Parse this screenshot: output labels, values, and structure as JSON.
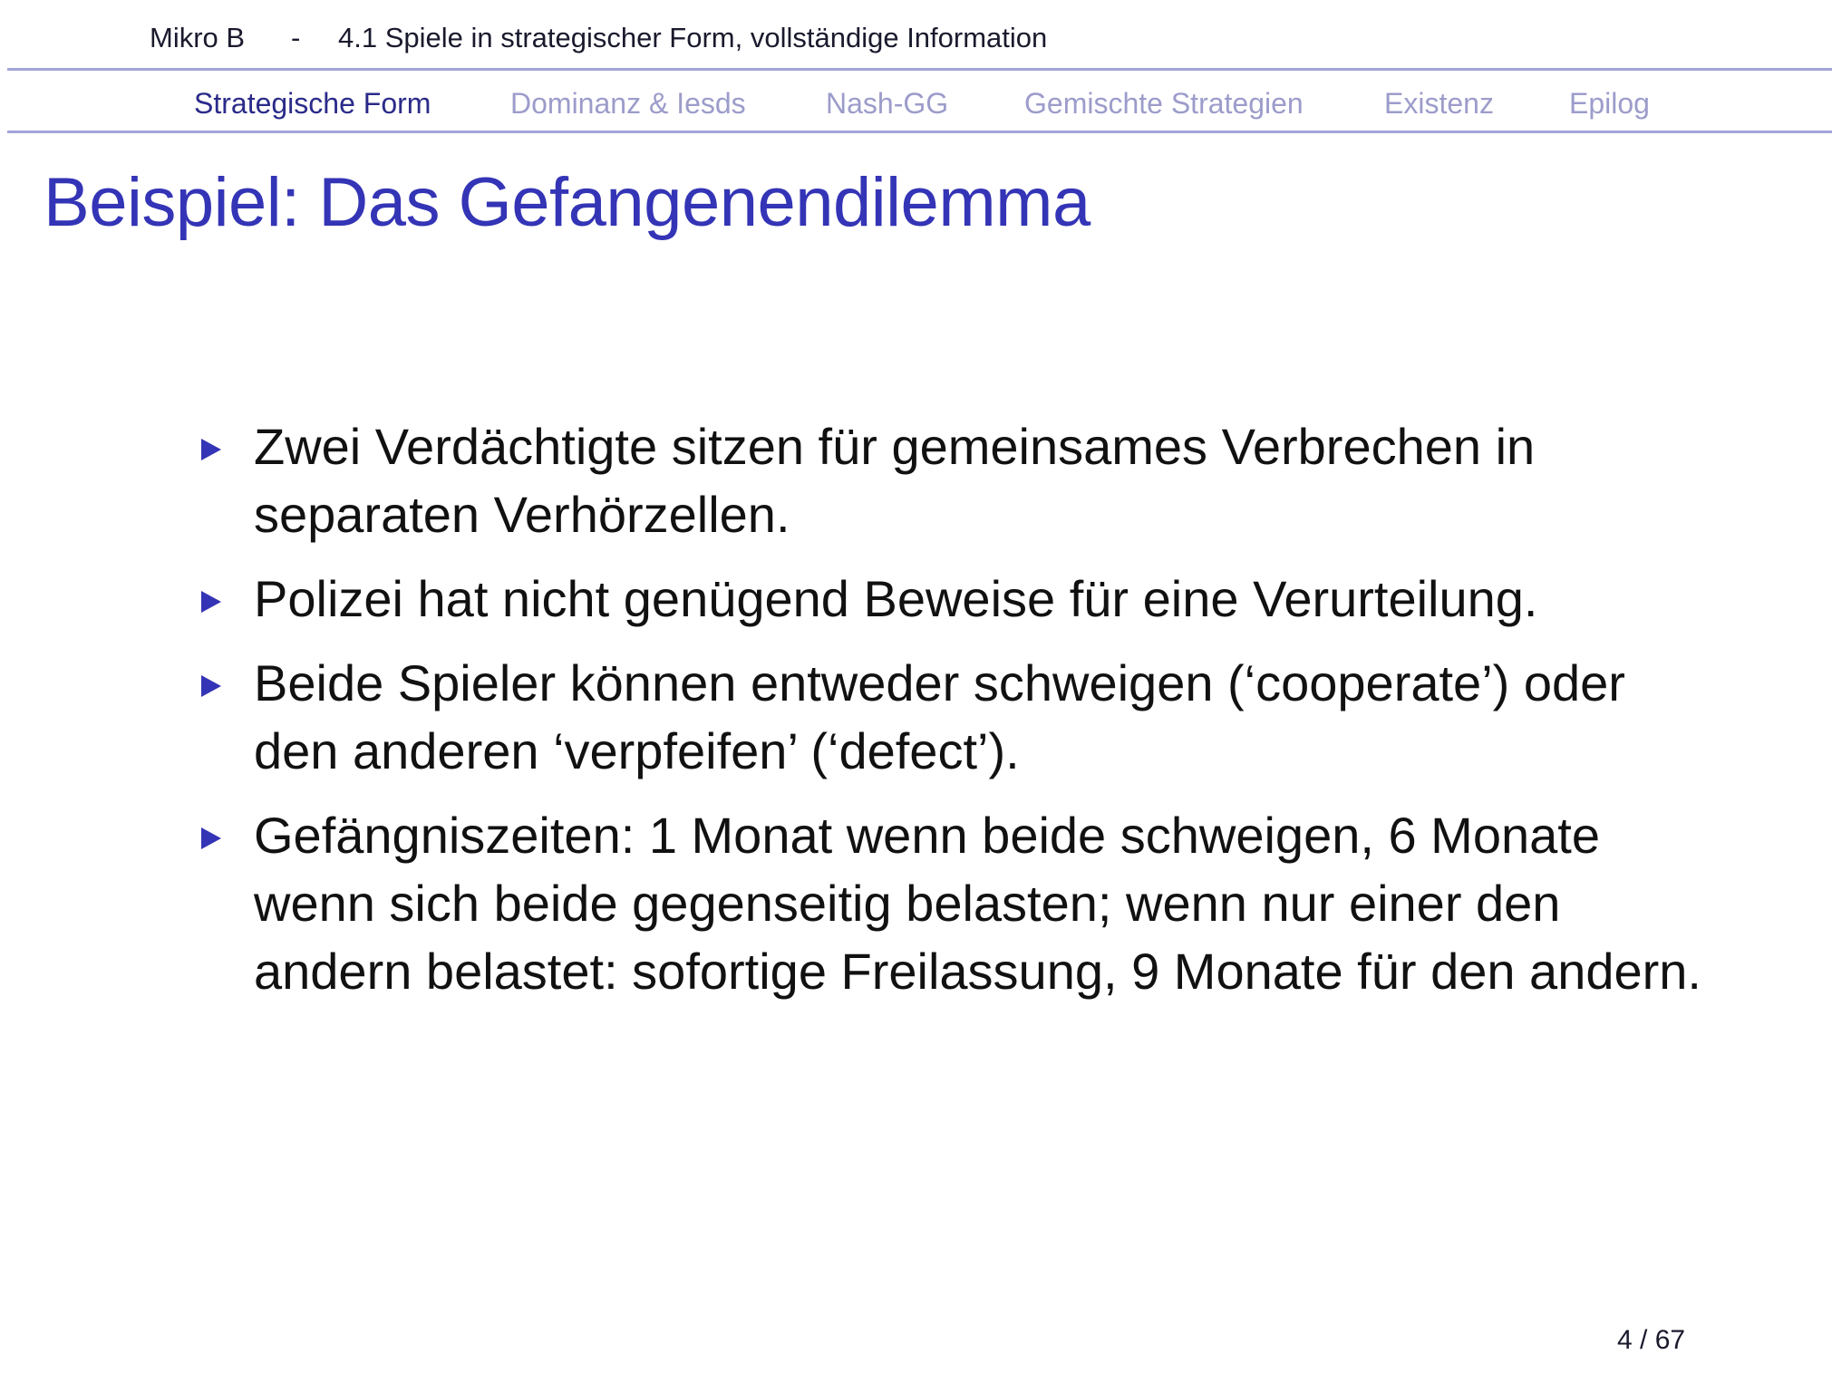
{
  "header": {
    "course": "Mikro B",
    "separator": "-",
    "section": "4.1 Spiele in strategischer Form, vollständige Information"
  },
  "nav": {
    "items": [
      {
        "label": "Strategische Form",
        "active": true
      },
      {
        "label": "Dominanz & Iesds",
        "active": false
      },
      {
        "label": "Nash-GG",
        "active": false
      },
      {
        "label": "Gemischte Strategien",
        "active": false
      },
      {
        "label": "Existenz",
        "active": false
      },
      {
        "label": "Epilog",
        "active": false
      }
    ]
  },
  "slide": {
    "title": "Beispiel: Das Gefangenendilemma",
    "bullets": [
      "Zwei Verdächtigte sitzen für gemeinsames Verbrechen in separaten Verhörzellen.",
      "Polizei hat nicht genügend Beweise für eine Verurteilung.",
      "Beide Spieler können entweder schweigen (‘cooperate’) oder den anderen ‘verpfeifen’ (‘defect’).",
      "Gefängniszeiten: 1 Monat wenn beide schweigen, 6 Monate wenn sich beide gegenseitig belasten; wenn nur einer den andern belastet: sofortige Freilassung, 9 Monate für den andern."
    ]
  },
  "footer": {
    "page": "4 / 67"
  },
  "colors": {
    "title": "#3434b6",
    "nav_active": "#2b2b8a",
    "nav_inactive": "#9c9ccb",
    "rule": "#a4a4da"
  }
}
